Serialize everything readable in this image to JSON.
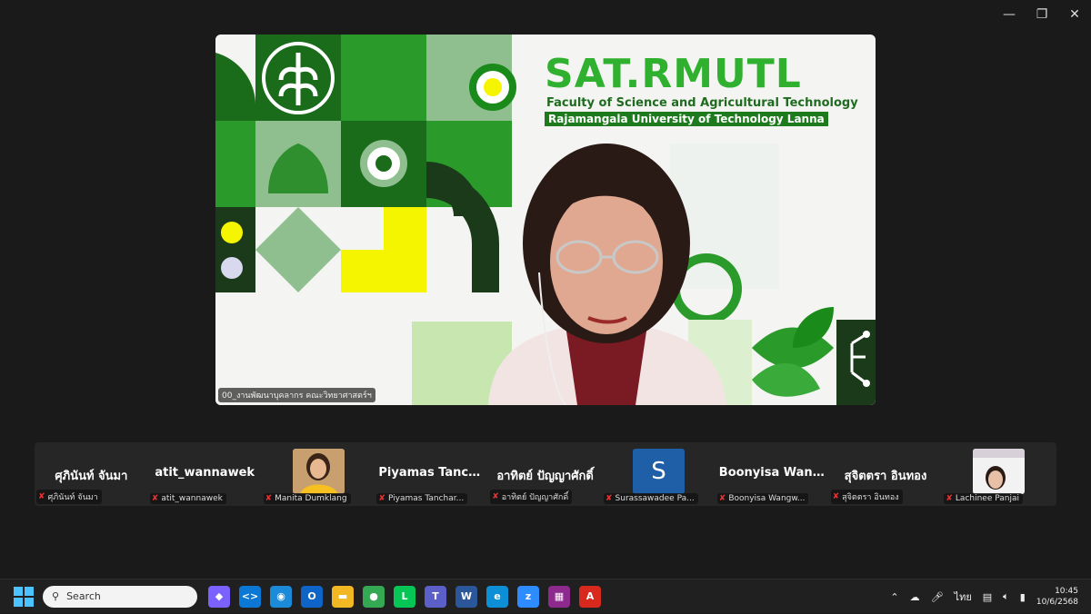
{
  "window": {
    "minimize_icon": "minimize-icon",
    "restore_icon": "restore-icon",
    "close_icon": "close-icon"
  },
  "speaker": {
    "label": "00_งานพัฒนาบุคลากร คณะวิทยาศาสตร์ฯ",
    "brand_title": "SAT.RMUTL",
    "brand_subtitle": "Faculty of Science and Agricultural Technology",
    "brand_university": "Rajamangala University of Technology Lanna"
  },
  "participants": [
    {
      "name": "ศุภินันท์ จันมา",
      "label": "ศุภินันท์ จันมา",
      "type": "name"
    },
    {
      "name": "atit_wannawek",
      "label": "atit_wannawek",
      "type": "name"
    },
    {
      "name": "",
      "label": "Manita Dumklang",
      "type": "photo"
    },
    {
      "name": "Piyamas Tancha...",
      "label": "Piyamas Tanchar...",
      "type": "name"
    },
    {
      "name": "อาทิตย์ ปัญญาศักดิ์",
      "label": "อาทิตย์ ปัญญาศักดิ์",
      "type": "name"
    },
    {
      "name": "S",
      "label": "Surassawadee Pa...",
      "type": "initial"
    },
    {
      "name": "Boonyisa Wang...",
      "label": "Boonyisa Wangw...",
      "type": "name"
    },
    {
      "name": "สุจิตตรา อินทอง",
      "label": "สุจิตตรา อินทอง",
      "type": "name"
    },
    {
      "name": "",
      "label": "Lachinee Panjai",
      "type": "photo"
    }
  ],
  "taskbar": {
    "search_placeholder": "Search",
    "apps": [
      {
        "icon": "copilot-icon",
        "color": "#7b61ff",
        "glyph": "◆"
      },
      {
        "icon": "vscode-icon",
        "color": "#0a78d4",
        "glyph": "<>"
      },
      {
        "icon": "browser-app-icon",
        "color": "#1b8ad8",
        "glyph": "◉"
      },
      {
        "icon": "outlook-icon",
        "color": "#0f64c8",
        "glyph": "O"
      },
      {
        "icon": "file-explorer-icon",
        "color": "#f2b824",
        "glyph": "▬"
      },
      {
        "icon": "chrome-icon",
        "color": "#34a853",
        "glyph": "●"
      },
      {
        "icon": "line-icon",
        "color": "#06c755",
        "glyph": "L"
      },
      {
        "icon": "teams-icon",
        "color": "#5b5fc7",
        "glyph": "T"
      },
      {
        "icon": "word-icon",
        "color": "#2b579a",
        "glyph": "W"
      },
      {
        "icon": "edge-icon",
        "color": "#0c8fd6",
        "glyph": "e"
      },
      {
        "icon": "zoom-icon",
        "color": "#2d8cff",
        "glyph": "z"
      },
      {
        "icon": "winrar-icon",
        "color": "#8e2a8e",
        "glyph": "▦"
      },
      {
        "icon": "acrobat-icon",
        "color": "#d9281e",
        "glyph": "A"
      }
    ],
    "language": "ไทย",
    "time": "10:45",
    "date": "10/6/2568"
  }
}
